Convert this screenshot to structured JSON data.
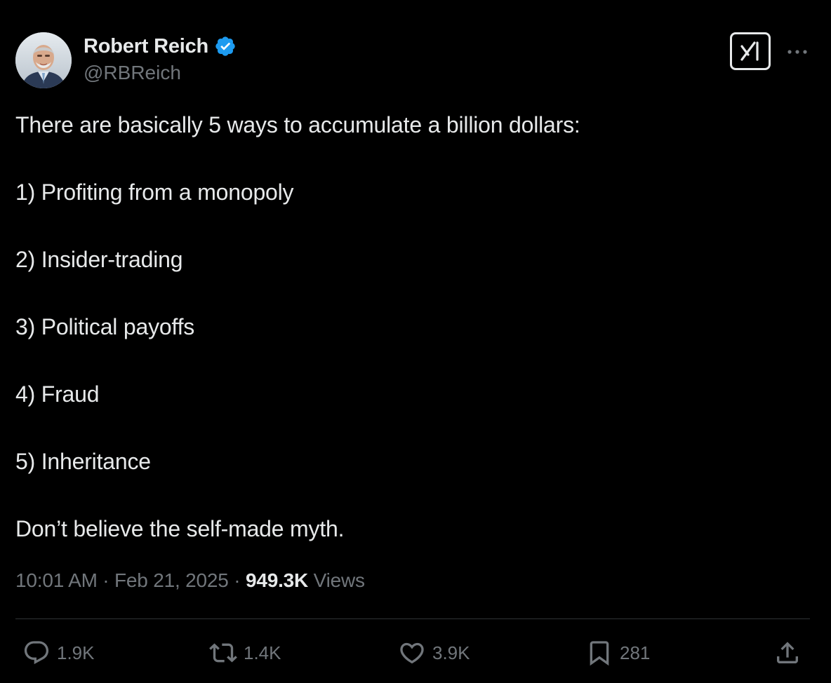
{
  "author": {
    "display_name": "Robert Reich",
    "handle": "@RBReich",
    "verified": true,
    "avatar_icon": "avatar-photo"
  },
  "header_actions": {
    "grok_icon": "grok-icon",
    "more_icon": "more-icon"
  },
  "post": {
    "intro": "There are basically 5 ways to accumulate a billion dollars:",
    "items": [
      "1) Profiting from a monopoly",
      "2) Insider-trading",
      "3) Political payoffs",
      "4) Fraud",
      "5) Inheritance"
    ],
    "closing": "Don’t believe the self-made myth."
  },
  "meta": {
    "time": "10:01 AM",
    "separator": "·",
    "date": "Feb 21, 2025",
    "views_count": "949.3K",
    "views_label": "Views"
  },
  "actions": {
    "replies": "1.9K",
    "reposts": "1.4K",
    "likes": "3.9K",
    "bookmarks": "281"
  },
  "colors": {
    "background": "#000000",
    "text_primary": "#e7e9ea",
    "text_secondary": "#71767b",
    "verified_blue": "#1d9bf0",
    "divider": "#2f3336"
  }
}
